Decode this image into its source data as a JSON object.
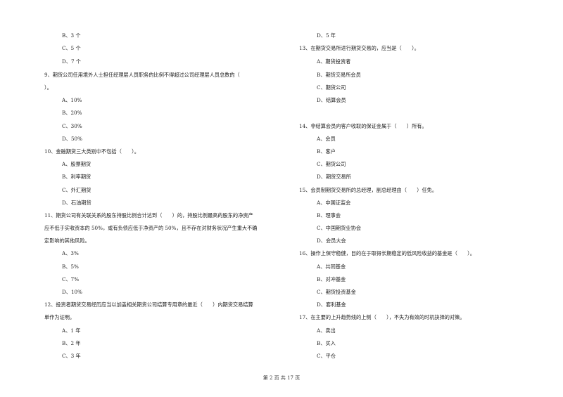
{
  "left_column": {
    "items": [
      {
        "type": "option",
        "text": "B、3 个"
      },
      {
        "type": "option",
        "text": "C、5 个"
      },
      {
        "type": "option",
        "text": "D、7 个"
      },
      {
        "type": "question",
        "text": "9、期货公司任用境外人士担任经理层人员职务的比例不得超过公司经理层人员总数的（"
      },
      {
        "type": "question",
        "text": "）。"
      },
      {
        "type": "option",
        "text": "A、10%"
      },
      {
        "type": "option",
        "text": "B、20%"
      },
      {
        "type": "option",
        "text": "C、30%"
      },
      {
        "type": "option",
        "text": "D、50%"
      },
      {
        "type": "question",
        "text": "10、金融期货三大类别中不包括（　　）。"
      },
      {
        "type": "option",
        "text": "A、股票期货"
      },
      {
        "type": "option",
        "text": "B、利率期货"
      },
      {
        "type": "option",
        "text": "C、外汇期货"
      },
      {
        "type": "option",
        "text": "D、石油期货"
      },
      {
        "type": "question",
        "text": "11、期货公司有关联关系的股东持股比例合计达到（　　）的，持股比例最高的股东的净资产"
      },
      {
        "type": "question",
        "text": "应不低于实收资本的 50%，或有负债应低于净资产的 50%，且不存在对财务状况产生重大不确"
      },
      {
        "type": "question",
        "text": "定影响的其他风险。"
      },
      {
        "type": "option",
        "text": "A、3%"
      },
      {
        "type": "option",
        "text": "B、5%"
      },
      {
        "type": "option",
        "text": "C、7%"
      },
      {
        "type": "option",
        "text": "D、10%"
      },
      {
        "type": "question",
        "text": "12、投资者期货交易经历应当以加盖相关期货公司结算专用章的最近（　　）内期货交易结算"
      },
      {
        "type": "question",
        "text": "单作为证明。"
      },
      {
        "type": "option",
        "text": "A、1 年"
      },
      {
        "type": "option",
        "text": "B、2 年"
      },
      {
        "type": "option",
        "text": "C、3 年"
      }
    ]
  },
  "right_column": {
    "items": [
      {
        "type": "option",
        "text": "D、5 年"
      },
      {
        "type": "question",
        "text": "13、在期货交易所进行期货交易的，应当是（　　）。"
      },
      {
        "type": "option",
        "text": "A、期货投资者"
      },
      {
        "type": "option",
        "text": "B、期货交易所会员"
      },
      {
        "type": "option",
        "text": "C、期货公司"
      },
      {
        "type": "option",
        "text": "D、结算会员"
      },
      {
        "type": "question",
        "text": "14、非结算会员向客户收取的保证金属于（　　）所有。"
      },
      {
        "type": "option",
        "text": "A、会员"
      },
      {
        "type": "option",
        "text": "B、客户"
      },
      {
        "type": "option",
        "text": "C、期货公司"
      },
      {
        "type": "option",
        "text": "D、期货交易所"
      },
      {
        "type": "question",
        "text": "15、会员制期货交易所的总经理，副总经理由（　　）任免。"
      },
      {
        "type": "option",
        "text": "A、中国证监会"
      },
      {
        "type": "option",
        "text": "B、理事会"
      },
      {
        "type": "option",
        "text": "C、中国期货业协会"
      },
      {
        "type": "option",
        "text": "D、会员大会"
      },
      {
        "type": "question",
        "text": "16、操作上保守稳健，目的在于取得长期稳定的低风险收益的基金是（　　）。"
      },
      {
        "type": "option",
        "text": "A、共同基金"
      },
      {
        "type": "option",
        "text": "B、对冲基金"
      },
      {
        "type": "option",
        "text": "C、期货投资基金"
      },
      {
        "type": "option",
        "text": "D、套利基金"
      },
      {
        "type": "question",
        "text": "17、在主要的上升趋势线的上侧（　　），不失为有效的时机抉择的对策。"
      },
      {
        "type": "option",
        "text": "A、卖出"
      },
      {
        "type": "option",
        "text": "B、买入"
      },
      {
        "type": "option",
        "text": "C、平仓"
      }
    ]
  },
  "footer": {
    "page_indicator": "第 2 页 共 17 页"
  }
}
